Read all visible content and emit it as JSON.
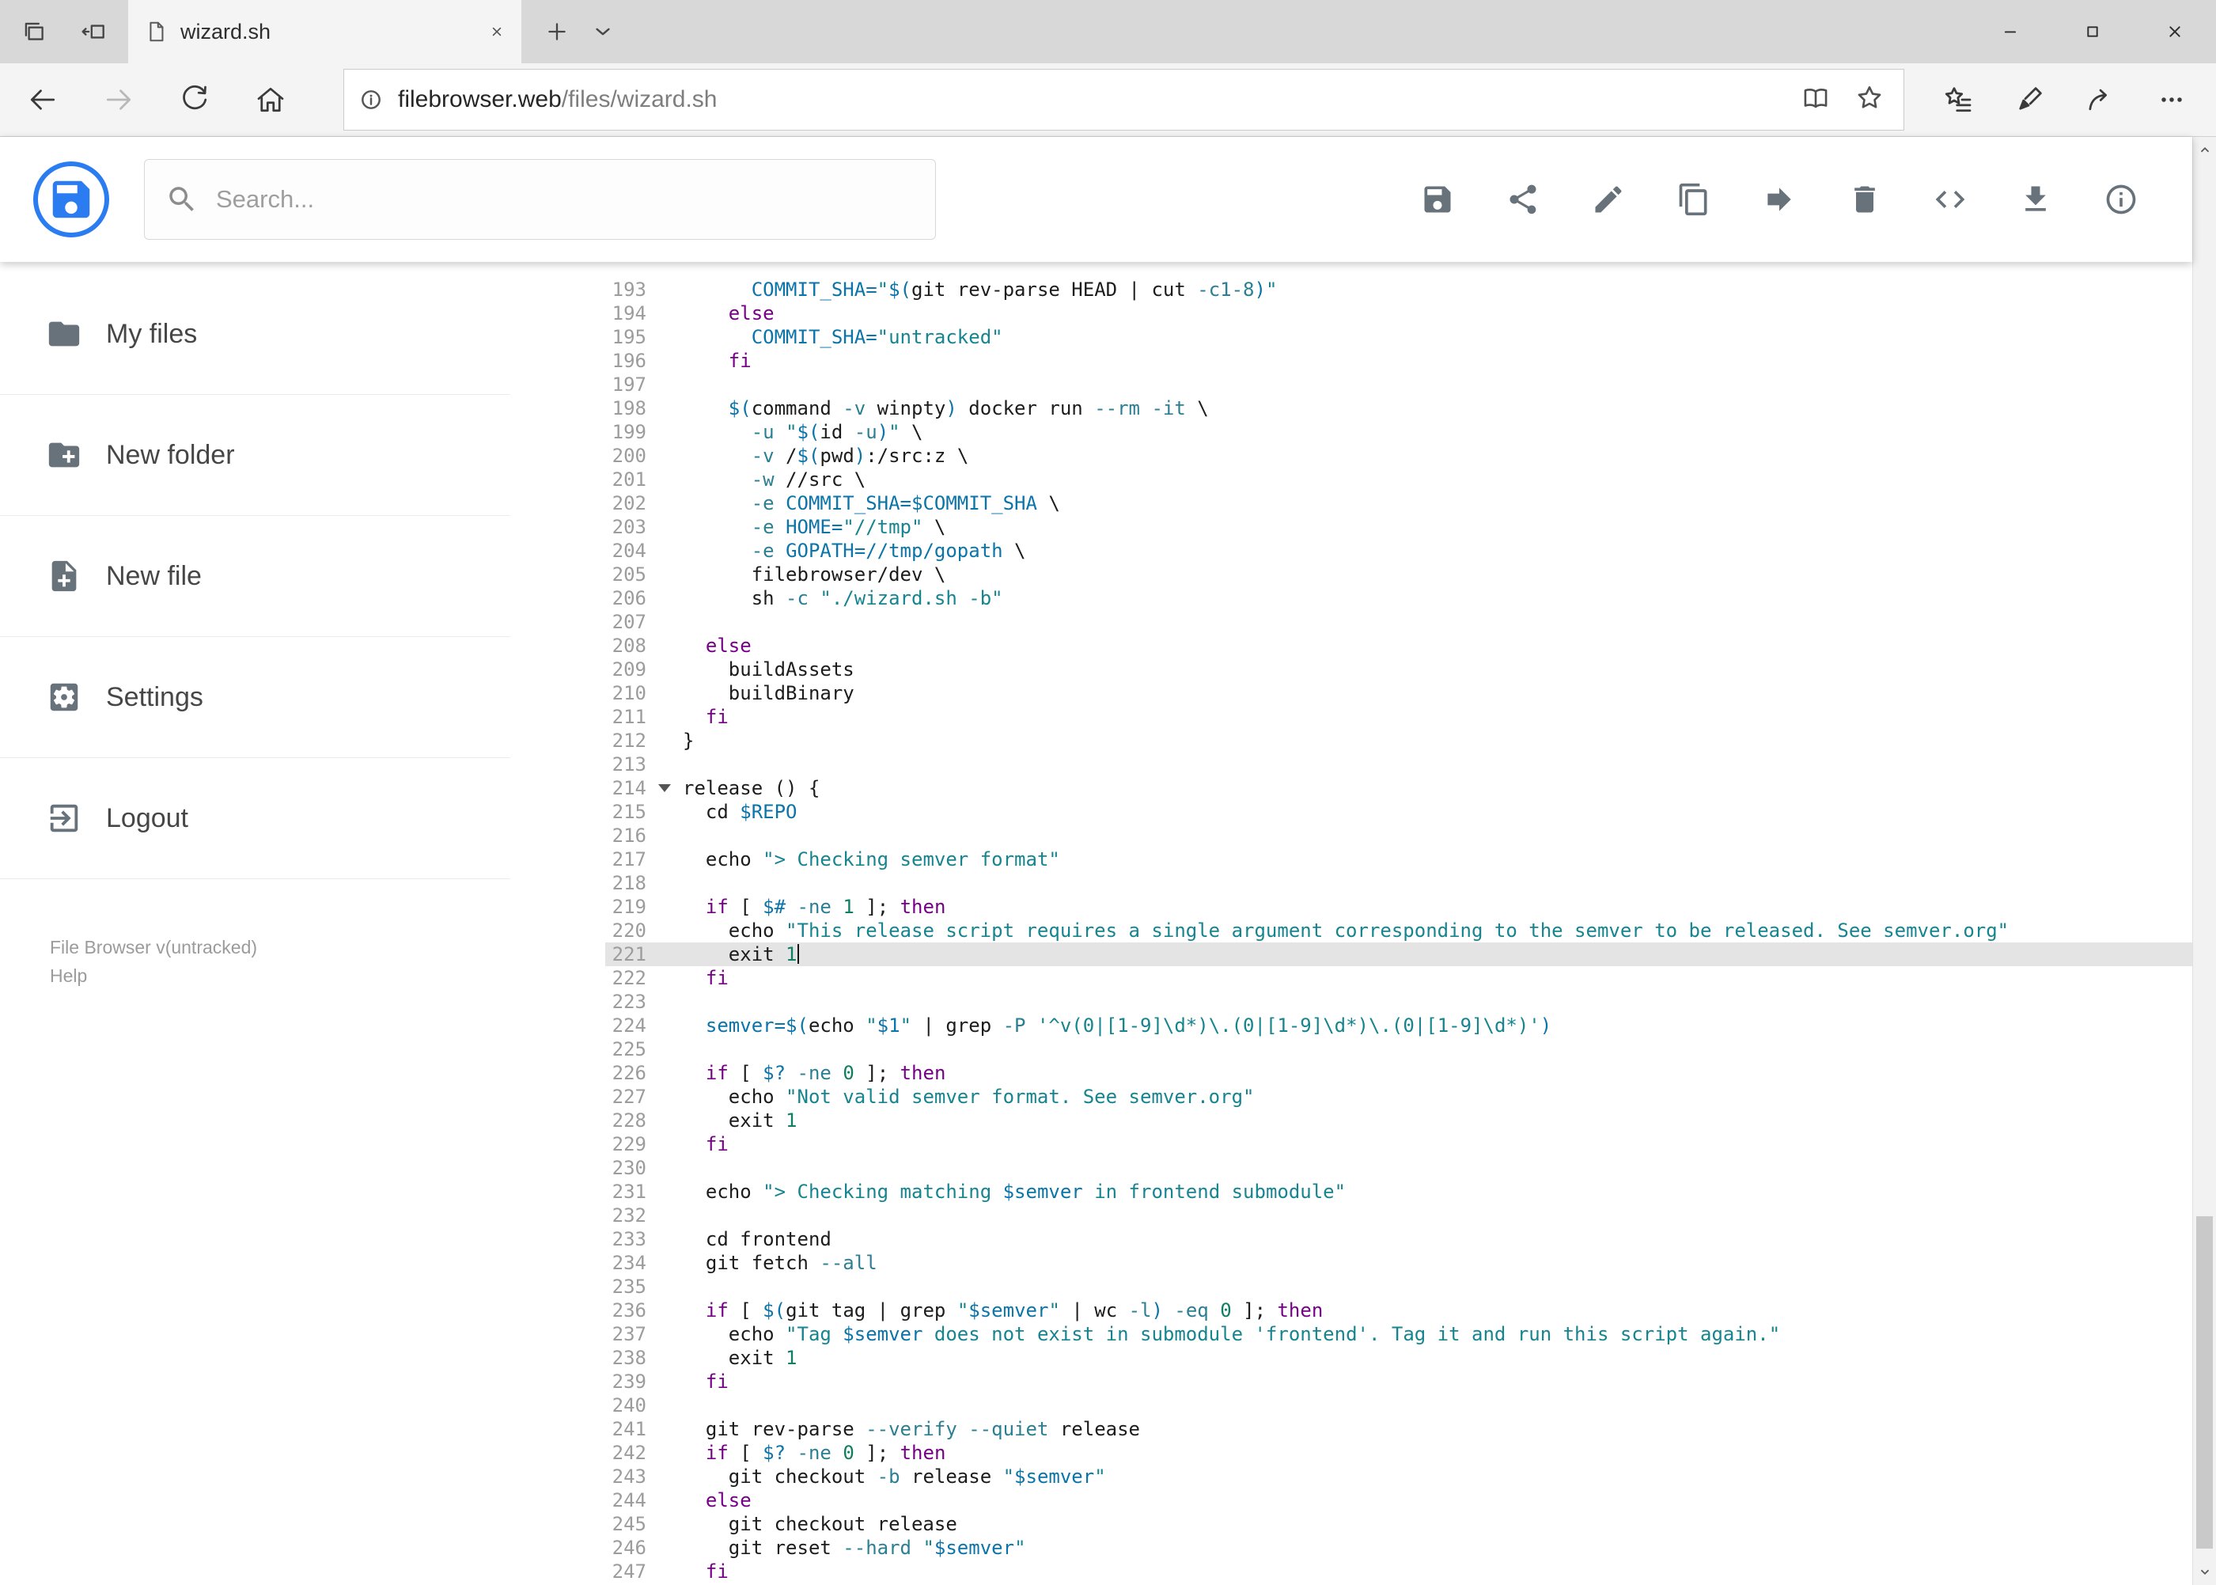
{
  "browser": {
    "tab_bar": {
      "left_icons": [
        "tabs-set-aside-icon",
        "set-tabs-aside-icon"
      ],
      "tab": {
        "title": "wizard.sh",
        "favicon": "page-icon",
        "close_icon": "close-icon"
      },
      "new_tab_icon": "plus-icon",
      "preview_icon": "chevron-down-icon",
      "window_controls": [
        {
          "name": "minimize",
          "icon": "minimize-icon"
        },
        {
          "name": "maximize",
          "icon": "maximize-icon"
        },
        {
          "name": "close-window",
          "icon": "close-icon"
        }
      ]
    },
    "nav": {
      "buttons": [
        {
          "name": "back",
          "icon": "back-icon"
        },
        {
          "name": "forward",
          "icon": "forward-icon",
          "disabled": true
        },
        {
          "name": "refresh",
          "icon": "refresh-icon"
        },
        {
          "name": "home",
          "icon": "home-icon"
        }
      ],
      "address": {
        "badge_icon": "info-badge-icon",
        "host": "filebrowser.web",
        "path": "/files/wizard.sh",
        "actions": [
          {
            "name": "reading-view",
            "icon": "book-icon"
          },
          {
            "name": "add-favorite",
            "icon": "star-icon"
          }
        ]
      },
      "actions": [
        {
          "name": "hub-favorites",
          "icon": "hub-icon"
        },
        {
          "name": "web-note",
          "icon": "pen-icon"
        },
        {
          "name": "share",
          "icon": "share-arrow-icon"
        },
        {
          "name": "more",
          "icon": "ellipsis-icon"
        }
      ]
    }
  },
  "app": {
    "logo_icon": "floppy-logo-icon",
    "search": {
      "placeholder": "Search...",
      "icon": "search-icon"
    },
    "toolbar": [
      {
        "name": "save",
        "icon": "save-icon"
      },
      {
        "name": "share",
        "icon": "share-icon"
      },
      {
        "name": "rename",
        "icon": "rename-icon"
      },
      {
        "name": "copy",
        "icon": "copy-icon"
      },
      {
        "name": "move",
        "icon": "move-icon"
      },
      {
        "name": "delete",
        "icon": "delete-icon"
      },
      {
        "name": "source-code",
        "icon": "source-code-icon"
      },
      {
        "name": "download",
        "icon": "download-icon"
      },
      {
        "name": "info",
        "icon": "info-icon"
      }
    ],
    "sidebar": {
      "items": [
        {
          "icon": "folder-icon",
          "label": "My files"
        },
        {
          "icon": "new-folder-icon",
          "label": "New folder"
        },
        {
          "icon": "new-file-icon",
          "label": "New file"
        },
        {
          "icon": "settings-icon",
          "label": "Settings"
        },
        {
          "icon": "logout-icon",
          "label": "Logout"
        }
      ],
      "footer": {
        "version": "File Browser v(untracked)",
        "help": "Help"
      }
    }
  },
  "scrollbar": {
    "up_icon": "scroll-up-icon",
    "down_icon": "scroll-down-icon"
  },
  "editor": {
    "active_line": 221,
    "cursor_line": 221,
    "lines": [
      {
        "n": 193,
        "t": [
          [
            "p",
            "      "
          ],
          [
            "v",
            "COMMIT_SHA="
          ],
          [
            "s",
            "\""
          ],
          [
            "v",
            "$("
          ],
          [
            "p",
            "git rev-parse HEAD | cut "
          ],
          [
            "f",
            "-c1-8"
          ],
          [
            "v",
            ")"
          ],
          [
            "s",
            "\""
          ]
        ]
      },
      {
        "n": 194,
        "t": [
          [
            "p",
            "    "
          ],
          [
            "k",
            "else"
          ]
        ]
      },
      {
        "n": 195,
        "t": [
          [
            "p",
            "      "
          ],
          [
            "v",
            "COMMIT_SHA="
          ],
          [
            "s",
            "\"untracked\""
          ]
        ]
      },
      {
        "n": 196,
        "t": [
          [
            "p",
            "    "
          ],
          [
            "k",
            "fi"
          ]
        ]
      },
      {
        "n": 197,
        "t": []
      },
      {
        "n": 198,
        "t": [
          [
            "p",
            "    "
          ],
          [
            "v",
            "$("
          ],
          [
            "p",
            "command "
          ],
          [
            "f",
            "-v"
          ],
          [
            "p",
            " winpty"
          ],
          [
            "v",
            ")"
          ],
          [
            "p",
            " docker run "
          ],
          [
            "f",
            "--rm"
          ],
          [
            "p",
            " "
          ],
          [
            "f",
            "-it"
          ],
          [
            "p",
            " \\"
          ]
        ]
      },
      {
        "n": 199,
        "t": [
          [
            "p",
            "      "
          ],
          [
            "f",
            "-u"
          ],
          [
            "p",
            " "
          ],
          [
            "s",
            "\""
          ],
          [
            "v",
            "$("
          ],
          [
            "p",
            "id "
          ],
          [
            "f",
            "-u"
          ],
          [
            "v",
            ")"
          ],
          [
            "s",
            "\""
          ],
          [
            "p",
            " \\"
          ]
        ]
      },
      {
        "n": 200,
        "t": [
          [
            "p",
            "      "
          ],
          [
            "f",
            "-v"
          ],
          [
            "p",
            " /"
          ],
          [
            "v",
            "$("
          ],
          [
            "p",
            "pwd"
          ],
          [
            "v",
            ")"
          ],
          [
            "p",
            ":/src:z \\"
          ]
        ]
      },
      {
        "n": 201,
        "t": [
          [
            "p",
            "      "
          ],
          [
            "f",
            "-w"
          ],
          [
            "p",
            " //src \\"
          ]
        ]
      },
      {
        "n": 202,
        "t": [
          [
            "p",
            "      "
          ],
          [
            "f",
            "-e"
          ],
          [
            "p",
            " "
          ],
          [
            "v",
            "COMMIT_SHA=$COMMIT_SHA"
          ],
          [
            "p",
            " \\"
          ]
        ]
      },
      {
        "n": 203,
        "t": [
          [
            "p",
            "      "
          ],
          [
            "f",
            "-e"
          ],
          [
            "p",
            " "
          ],
          [
            "v",
            "HOME="
          ],
          [
            "s",
            "\"//tmp\""
          ],
          [
            "p",
            " \\"
          ]
        ]
      },
      {
        "n": 204,
        "t": [
          [
            "p",
            "      "
          ],
          [
            "f",
            "-e"
          ],
          [
            "p",
            " "
          ],
          [
            "v",
            "GOPATH=//tmp/gopath"
          ],
          [
            "p",
            " \\"
          ]
        ]
      },
      {
        "n": 205,
        "t": [
          [
            "p",
            "      filebrowser/dev \\"
          ]
        ]
      },
      {
        "n": 206,
        "t": [
          [
            "p",
            "      sh "
          ],
          [
            "f",
            "-c"
          ],
          [
            "p",
            " "
          ],
          [
            "s",
            "\"./wizard.sh -b\""
          ]
        ]
      },
      {
        "n": 207,
        "t": []
      },
      {
        "n": 208,
        "t": [
          [
            "p",
            "  "
          ],
          [
            "k",
            "else"
          ]
        ]
      },
      {
        "n": 209,
        "t": [
          [
            "p",
            "    buildAssets"
          ]
        ]
      },
      {
        "n": 210,
        "t": [
          [
            "p",
            "    buildBinary"
          ]
        ]
      },
      {
        "n": 211,
        "t": [
          [
            "p",
            "  "
          ],
          [
            "k",
            "fi"
          ]
        ]
      },
      {
        "n": 212,
        "t": [
          [
            "p",
            "}"
          ]
        ]
      },
      {
        "n": 213,
        "t": []
      },
      {
        "n": 214,
        "fold": true,
        "t": [
          [
            "p",
            "release () {"
          ]
        ]
      },
      {
        "n": 215,
        "t": [
          [
            "p",
            "  cd "
          ],
          [
            "v",
            "$REPO"
          ]
        ]
      },
      {
        "n": 216,
        "t": []
      },
      {
        "n": 217,
        "t": [
          [
            "p",
            "  echo "
          ],
          [
            "s",
            "\"> Checking semver format\""
          ]
        ]
      },
      {
        "n": 218,
        "t": []
      },
      {
        "n": 219,
        "t": [
          [
            "p",
            "  "
          ],
          [
            "k",
            "if"
          ],
          [
            "p",
            " [ "
          ],
          [
            "v",
            "$#"
          ],
          [
            "p",
            " "
          ],
          [
            "f",
            "-ne"
          ],
          [
            "p",
            " "
          ],
          [
            "n",
            "1"
          ],
          [
            "p",
            " ]; "
          ],
          [
            "k",
            "then"
          ]
        ]
      },
      {
        "n": 220,
        "t": [
          [
            "p",
            "    echo "
          ],
          [
            "s",
            "\"This release script requires a single argument corresponding to the semver to be released. See semver.org\""
          ]
        ]
      },
      {
        "n": 221,
        "t": [
          [
            "p",
            "    exit "
          ],
          [
            "n",
            "1"
          ]
        ]
      },
      {
        "n": 222,
        "t": [
          [
            "p",
            "  "
          ],
          [
            "k",
            "fi"
          ]
        ]
      },
      {
        "n": 223,
        "t": []
      },
      {
        "n": 224,
        "t": [
          [
            "p",
            "  "
          ],
          [
            "v",
            "semver=$("
          ],
          [
            "p",
            "echo "
          ],
          [
            "s",
            "\""
          ],
          [
            "v",
            "$1"
          ],
          [
            "s",
            "\""
          ],
          [
            "p",
            " | grep "
          ],
          [
            "f",
            "-P"
          ],
          [
            "p",
            " "
          ],
          [
            "s",
            "'^v(0|[1-9]\\d*)\\.(0|[1-9]\\d*)\\.(0|[1-9]\\d*)'"
          ],
          [
            "v",
            ")"
          ]
        ]
      },
      {
        "n": 225,
        "t": []
      },
      {
        "n": 226,
        "t": [
          [
            "p",
            "  "
          ],
          [
            "k",
            "if"
          ],
          [
            "p",
            " [ "
          ],
          [
            "v",
            "$?"
          ],
          [
            "p",
            " "
          ],
          [
            "f",
            "-ne"
          ],
          [
            "p",
            " "
          ],
          [
            "n",
            "0"
          ],
          [
            "p",
            " ]; "
          ],
          [
            "k",
            "then"
          ]
        ]
      },
      {
        "n": 227,
        "t": [
          [
            "p",
            "    echo "
          ],
          [
            "s",
            "\"Not valid semver format. See semver.org\""
          ]
        ]
      },
      {
        "n": 228,
        "t": [
          [
            "p",
            "    exit "
          ],
          [
            "n",
            "1"
          ]
        ]
      },
      {
        "n": 229,
        "t": [
          [
            "p",
            "  "
          ],
          [
            "k",
            "fi"
          ]
        ]
      },
      {
        "n": 230,
        "t": []
      },
      {
        "n": 231,
        "t": [
          [
            "p",
            "  echo "
          ],
          [
            "s",
            "\"> Checking matching "
          ],
          [
            "v",
            "$semver"
          ],
          [
            "s",
            " in frontend submodule\""
          ]
        ]
      },
      {
        "n": 232,
        "t": []
      },
      {
        "n": 233,
        "t": [
          [
            "p",
            "  cd frontend"
          ]
        ]
      },
      {
        "n": 234,
        "t": [
          [
            "p",
            "  git fetch "
          ],
          [
            "f",
            "--all"
          ]
        ]
      },
      {
        "n": 235,
        "t": []
      },
      {
        "n": 236,
        "t": [
          [
            "p",
            "  "
          ],
          [
            "k",
            "if"
          ],
          [
            "p",
            " [ "
          ],
          [
            "v",
            "$("
          ],
          [
            "p",
            "git tag | grep "
          ],
          [
            "s",
            "\""
          ],
          [
            "v",
            "$semver"
          ],
          [
            "s",
            "\""
          ],
          [
            "p",
            " | wc "
          ],
          [
            "f",
            "-l"
          ],
          [
            "v",
            ")"
          ],
          [
            "p",
            " "
          ],
          [
            "f",
            "-eq"
          ],
          [
            "p",
            " "
          ],
          [
            "n",
            "0"
          ],
          [
            "p",
            " ]; "
          ],
          [
            "k",
            "then"
          ]
        ]
      },
      {
        "n": 237,
        "t": [
          [
            "p",
            "    echo "
          ],
          [
            "s",
            "\"Tag "
          ],
          [
            "v",
            "$semver"
          ],
          [
            "s",
            " does not exist in submodule 'frontend'. Tag it and run this script again.\""
          ]
        ]
      },
      {
        "n": 238,
        "t": [
          [
            "p",
            "    exit "
          ],
          [
            "n",
            "1"
          ]
        ]
      },
      {
        "n": 239,
        "t": [
          [
            "p",
            "  "
          ],
          [
            "k",
            "fi"
          ]
        ]
      },
      {
        "n": 240,
        "t": []
      },
      {
        "n": 241,
        "t": [
          [
            "p",
            "  git rev-parse "
          ],
          [
            "f",
            "--verify"
          ],
          [
            "p",
            " "
          ],
          [
            "f",
            "--quiet"
          ],
          [
            "p",
            " release"
          ]
        ]
      },
      {
        "n": 242,
        "t": [
          [
            "p",
            "  "
          ],
          [
            "k",
            "if"
          ],
          [
            "p",
            " [ "
          ],
          [
            "v",
            "$?"
          ],
          [
            "p",
            " "
          ],
          [
            "f",
            "-ne"
          ],
          [
            "p",
            " "
          ],
          [
            "n",
            "0"
          ],
          [
            "p",
            " ]; "
          ],
          [
            "k",
            "then"
          ]
        ]
      },
      {
        "n": 243,
        "t": [
          [
            "p",
            "    git checkout "
          ],
          [
            "f",
            "-b"
          ],
          [
            "p",
            " release "
          ],
          [
            "s",
            "\""
          ],
          [
            "v",
            "$semver"
          ],
          [
            "s",
            "\""
          ]
        ]
      },
      {
        "n": 244,
        "t": [
          [
            "p",
            "  "
          ],
          [
            "k",
            "else"
          ]
        ]
      },
      {
        "n": 245,
        "t": [
          [
            "p",
            "    git checkout release"
          ]
        ]
      },
      {
        "n": 246,
        "t": [
          [
            "p",
            "    git reset "
          ],
          [
            "f",
            "--hard"
          ],
          [
            "p",
            " "
          ],
          [
            "s",
            "\""
          ],
          [
            "v",
            "$semver"
          ],
          [
            "s",
            "\""
          ]
        ]
      },
      {
        "n": 247,
        "t": [
          [
            "p",
            "  "
          ],
          [
            "k",
            "fi"
          ]
        ]
      }
    ]
  }
}
